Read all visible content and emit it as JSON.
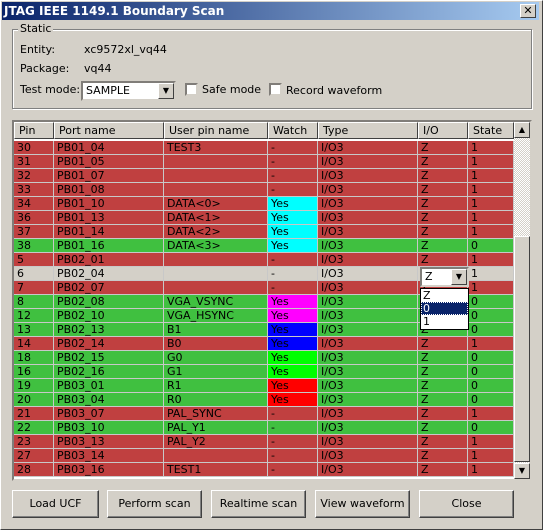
{
  "window": {
    "title": "JTAG IEEE 1149.1 Boundary Scan",
    "close_glyph": "✕"
  },
  "static": {
    "group_label": "Static",
    "entity_label": "Entity:",
    "entity_value": "xc9572xl_vq44",
    "package_label": "Package:",
    "package_value": "vq44",
    "test_mode_label": "Test mode:",
    "test_mode_value": "SAMPLE",
    "safe_mode_label": "Safe mode",
    "safe_mode_checked": false,
    "record_waveform_label": "Record waveform",
    "record_waveform_checked": false
  },
  "colors": {
    "state_1": "#c04040",
    "state_0": "#40c040",
    "selected_row": "#d4d0c8",
    "dropdown_highlight": "#0a246a"
  },
  "table": {
    "columns": [
      "Pin",
      "Port name",
      "User pin name",
      "Watch",
      "Type",
      "I/O",
      "State"
    ],
    "rows": [
      {
        "pin": "30",
        "port": "PB01_04",
        "user": "TEST3",
        "watch": "-",
        "watch_color": "",
        "type": "I/O3",
        "io": "Z",
        "state": "1"
      },
      {
        "pin": "31",
        "port": "PB01_05",
        "user": "",
        "watch": "-",
        "watch_color": "",
        "type": "I/O3",
        "io": "Z",
        "state": "1"
      },
      {
        "pin": "32",
        "port": "PB01_07",
        "user": "",
        "watch": "-",
        "watch_color": "",
        "type": "I/O3",
        "io": "Z",
        "state": "1"
      },
      {
        "pin": "33",
        "port": "PB01_08",
        "user": "",
        "watch": "-",
        "watch_color": "",
        "type": "I/O3",
        "io": "Z",
        "state": "1"
      },
      {
        "pin": "34",
        "port": "PB01_10",
        "user": "DATA<0>",
        "watch": "Yes",
        "watch_color": "#00ffff",
        "type": "I/O3",
        "io": "Z",
        "state": "1"
      },
      {
        "pin": "36",
        "port": "PB01_13",
        "user": "DATA<1>",
        "watch": "Yes",
        "watch_color": "#00ffff",
        "type": "I/O3",
        "io": "Z",
        "state": "1"
      },
      {
        "pin": "37",
        "port": "PB01_14",
        "user": "DATA<2>",
        "watch": "Yes",
        "watch_color": "#00ffff",
        "type": "I/O3",
        "io": "Z",
        "state": "1"
      },
      {
        "pin": "38",
        "port": "PB01_16",
        "user": "DATA<3>",
        "watch": "Yes",
        "watch_color": "#00ffff",
        "type": "I/O3",
        "io": "Z",
        "state": "0"
      },
      {
        "pin": "5",
        "port": "PB02_01",
        "user": "",
        "watch": "-",
        "watch_color": "",
        "type": "I/O3",
        "io": "Z",
        "state": "1"
      },
      {
        "pin": "6",
        "port": "PB02_04",
        "user": "",
        "watch": "-",
        "watch_color": "",
        "type": "I/O3",
        "io": "Z",
        "state": "1",
        "selected": true
      },
      {
        "pin": "7",
        "port": "PB02_07",
        "user": "",
        "watch": "-",
        "watch_color": "",
        "type": "I/O3",
        "io": "Z",
        "state": "1"
      },
      {
        "pin": "8",
        "port": "PB02_08",
        "user": "VGA_VSYNC",
        "watch": "Yes",
        "watch_color": "#ff00ff",
        "type": "I/O3",
        "io": "Z",
        "state": "0"
      },
      {
        "pin": "12",
        "port": "PB02_10",
        "user": "VGA_HSYNC",
        "watch": "Yes",
        "watch_color": "#ff00ff",
        "type": "I/O3",
        "io": "Z",
        "state": "0"
      },
      {
        "pin": "13",
        "port": "PB02_13",
        "user": "B1",
        "watch": "Yes",
        "watch_color": "#0000ff",
        "type": "I/O3",
        "io": "Z",
        "state": "0"
      },
      {
        "pin": "14",
        "port": "PB02_14",
        "user": "B0",
        "watch": "Yes",
        "watch_color": "#0000ff",
        "type": "I/O3",
        "io": "Z",
        "state": "1"
      },
      {
        "pin": "18",
        "port": "PB02_15",
        "user": "G0",
        "watch": "Yes",
        "watch_color": "#00ff00",
        "type": "I/O3",
        "io": "Z",
        "state": "0"
      },
      {
        "pin": "16",
        "port": "PB02_16",
        "user": "G1",
        "watch": "Yes",
        "watch_color": "#00ff00",
        "type": "I/O3",
        "io": "Z",
        "state": "0"
      },
      {
        "pin": "19",
        "port": "PB03_01",
        "user": "R1",
        "watch": "Yes",
        "watch_color": "#ff0000",
        "type": "I/O3",
        "io": "Z",
        "state": "0"
      },
      {
        "pin": "20",
        "port": "PB03_04",
        "user": "R0",
        "watch": "Yes",
        "watch_color": "#ff0000",
        "type": "I/O3",
        "io": "Z",
        "state": "0"
      },
      {
        "pin": "21",
        "port": "PB03_07",
        "user": "PAL_SYNC",
        "watch": "-",
        "watch_color": "",
        "type": "I/O3",
        "io": "Z",
        "state": "1"
      },
      {
        "pin": "22",
        "port": "PB03_10",
        "user": "PAL_Y1",
        "watch": "-",
        "watch_color": "",
        "type": "I/O3",
        "io": "Z",
        "state": "0"
      },
      {
        "pin": "23",
        "port": "PB03_13",
        "user": "PAL_Y2",
        "watch": "-",
        "watch_color": "",
        "type": "I/O3",
        "io": "Z",
        "state": "1"
      },
      {
        "pin": "27",
        "port": "PB03_14",
        "user": "",
        "watch": "-",
        "watch_color": "",
        "type": "I/O3",
        "io": "Z",
        "state": "1"
      },
      {
        "pin": "28",
        "port": "PB03_16",
        "user": "TEST1",
        "watch": "-",
        "watch_color": "",
        "type": "I/O3",
        "io": "Z",
        "state": "1"
      }
    ]
  },
  "io_dropdown": {
    "value": "Z",
    "options": [
      "Z",
      "0",
      "1"
    ],
    "highlighted": "0"
  },
  "buttons": {
    "load_ucf": "Load UCF",
    "perform_scan": "Perform scan",
    "realtime_scan": "Realtime scan",
    "view_waveform": "View waveform",
    "close": "Close"
  }
}
